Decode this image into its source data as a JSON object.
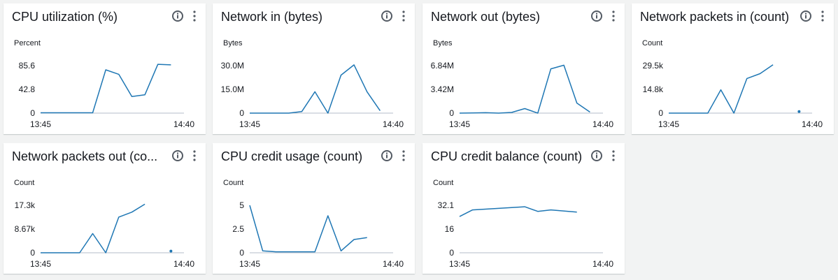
{
  "colors": {
    "line": "#1f77b4",
    "axis": "#b6bec9",
    "text": "#16191f",
    "icon": "#545b64"
  },
  "icons": {
    "info": "info-icon",
    "menu": "more-vertical-icon"
  },
  "widgets": [
    {
      "title": "CPU utilization (%)",
      "unit": "Percent"
    },
    {
      "title": "Network in (bytes)",
      "unit": "Bytes"
    },
    {
      "title": "Network out (bytes)",
      "unit": "Bytes"
    },
    {
      "title": "Network packets in (count)",
      "unit": "Count"
    },
    {
      "title": "Network packets out (co...",
      "unit": "Count"
    },
    {
      "title": "CPU credit usage (count)",
      "unit": "Count"
    },
    {
      "title": "CPU credit balance (count)",
      "unit": "Count"
    }
  ],
  "chart_data": [
    {
      "type": "line",
      "title": "CPU utilization (%)",
      "ylabel": "Percent",
      "x_tick_labels": [
        "13:45",
        "14:40"
      ],
      "xlim": [
        0,
        55
      ],
      "y_ticks": [
        0,
        42.8,
        85.6
      ],
      "y_tick_labels": [
        "0",
        "42.8",
        "85.6"
      ],
      "ylim": [
        0,
        85.6
      ],
      "segments": [
        [
          [
            0,
            0.6
          ],
          [
            20,
            0.6
          ],
          [
            25,
            78
          ],
          [
            30,
            70
          ],
          [
            35,
            30
          ],
          [
            40,
            33
          ],
          [
            45,
            88
          ],
          [
            50,
            87
          ]
        ]
      ],
      "points": []
    },
    {
      "type": "line",
      "title": "Network in (bytes)",
      "ylabel": "Bytes",
      "x_tick_labels": [
        "13:45",
        "14:40"
      ],
      "xlim": [
        0,
        55
      ],
      "y_ticks": [
        0,
        15000000,
        30000000
      ],
      "y_tick_labels": [
        "0",
        "15.0M",
        "30.0M"
      ],
      "ylim": [
        0,
        30000000
      ],
      "segments": [
        [
          [
            0,
            0
          ],
          [
            15,
            0
          ],
          [
            20,
            1000000
          ],
          [
            25,
            13500000
          ],
          [
            30,
            0
          ],
          [
            35,
            24000000
          ],
          [
            40,
            30500000
          ],
          [
            45,
            13500000
          ],
          [
            50,
            1500000
          ]
        ]
      ],
      "points": []
    },
    {
      "type": "line",
      "title": "Network out (bytes)",
      "ylabel": "Bytes",
      "x_tick_labels": [
        "13:45",
        "14:40"
      ],
      "xlim": [
        0,
        55
      ],
      "y_ticks": [
        0,
        3420000,
        6840000
      ],
      "y_tick_labels": [
        "0",
        "3.42M",
        "6.84M"
      ],
      "ylim": [
        0,
        6840000
      ],
      "segments": [
        [
          [
            0,
            0
          ],
          [
            5,
            30000
          ],
          [
            10,
            60000
          ],
          [
            15,
            0
          ],
          [
            20,
            100000
          ],
          [
            25,
            650000
          ],
          [
            30,
            0
          ],
          [
            35,
            6380000
          ],
          [
            40,
            6900000
          ],
          [
            45,
            1450000
          ],
          [
            50,
            150000
          ]
        ]
      ],
      "points": []
    },
    {
      "type": "line",
      "title": "Network packets in (count)",
      "ylabel": "Count",
      "x_tick_labels": [
        "13:45",
        "14:40"
      ],
      "xlim": [
        0,
        55
      ],
      "y_ticks": [
        0,
        14800,
        29500
      ],
      "y_tick_labels": [
        "0",
        "14.8k",
        "29.5k"
      ],
      "ylim": [
        0,
        29500
      ],
      "segments": [
        [
          [
            0,
            0
          ],
          [
            15,
            0
          ],
          [
            20,
            14500
          ],
          [
            25,
            0
          ],
          [
            30,
            21500
          ],
          [
            35,
            24500
          ],
          [
            40,
            30000
          ]
        ]
      ],
      "points": [
        [
          50,
          1000
        ]
      ]
    },
    {
      "type": "line",
      "title": "Network packets out (co...",
      "ylabel": "Count",
      "x_tick_labels": [
        "13:45",
        "14:40"
      ],
      "xlim": [
        0,
        55
      ],
      "y_ticks": [
        0,
        8670,
        17300
      ],
      "y_tick_labels": [
        "0",
        "8.67k",
        "17.3k"
      ],
      "ylim": [
        0,
        17300
      ],
      "segments": [
        [
          [
            0,
            0
          ],
          [
            15,
            0
          ],
          [
            20,
            7000
          ],
          [
            25,
            0
          ],
          [
            30,
            13000
          ],
          [
            35,
            14800
          ],
          [
            40,
            17700
          ]
        ]
      ],
      "points": [
        [
          50,
          600
        ]
      ]
    },
    {
      "type": "line",
      "title": "CPU credit usage (count)",
      "ylabel": "Count",
      "x_tick_labels": [
        "13:45",
        "14:40"
      ],
      "xlim": [
        0,
        55
      ],
      "y_ticks": [
        0,
        2.5,
        5
      ],
      "y_tick_labels": [
        "0",
        "2.5",
        "5"
      ],
      "ylim": [
        0,
        5
      ],
      "segments": [
        [
          [
            0,
            5
          ],
          [
            5,
            0.2
          ],
          [
            10,
            0.1
          ],
          [
            25,
            0.1
          ],
          [
            30,
            3.9
          ],
          [
            35,
            0.2
          ],
          [
            40,
            1.4
          ],
          [
            45,
            1.6
          ]
        ]
      ],
      "points": []
    },
    {
      "type": "line",
      "title": "CPU credit balance (count)",
      "ylabel": "Count",
      "x_tick_labels": [
        "13:45",
        "14:40"
      ],
      "xlim": [
        0,
        55
      ],
      "y_ticks": [
        0,
        16,
        32.1
      ],
      "y_tick_labels": [
        "0",
        "16",
        "32.1"
      ],
      "ylim": [
        0,
        32.1
      ],
      "segments": [
        [
          [
            0,
            24.5
          ],
          [
            5,
            29
          ],
          [
            25,
            31.1
          ],
          [
            30,
            28
          ],
          [
            35,
            29
          ],
          [
            45,
            27.5
          ]
        ]
      ],
      "points": []
    }
  ]
}
